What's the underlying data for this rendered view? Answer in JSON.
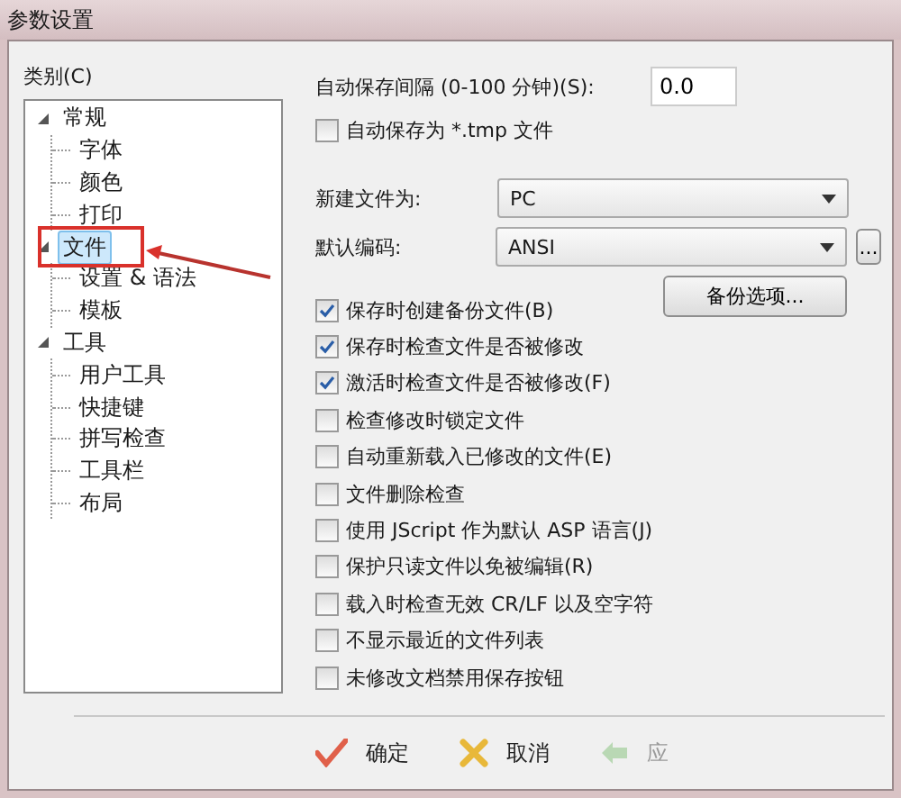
{
  "window": {
    "title": "参数设置"
  },
  "category": {
    "label": "类别(C)",
    "tree": [
      {
        "label": "常规",
        "expanded": true,
        "selected": false,
        "children": [
          {
            "label": "字体",
            "selected": false
          },
          {
            "label": "颜色",
            "selected": false
          },
          {
            "label": "打印",
            "selected": false
          }
        ]
      },
      {
        "label": "文件",
        "expanded": true,
        "selected": true,
        "children": [
          {
            "label": "设置 & 语法",
            "selected": false
          },
          {
            "label": "模板",
            "selected": false
          }
        ]
      },
      {
        "label": "工具",
        "expanded": true,
        "selected": false,
        "children": [
          {
            "label": "用户工具",
            "selected": false
          },
          {
            "label": "快捷键",
            "selected": false
          },
          {
            "label": "拼写检查",
            "selected": false
          },
          {
            "label": "工具栏",
            "selected": false
          },
          {
            "label": "布局",
            "selected": false
          }
        ]
      }
    ]
  },
  "autosave_interval": {
    "label": "自动保存间隔 (0-100 分钟)(S):",
    "value": "0.0"
  },
  "autosave_tmp": {
    "label": "自动保存为 *.tmp 文件",
    "checked": false
  },
  "new_file_as": {
    "label": "新建文件为:",
    "value": "PC"
  },
  "default_encoding": {
    "label": "默认编码:",
    "value": "ANSI",
    "more": "..."
  },
  "backup_button": "备份选项...",
  "options": [
    {
      "label": "保存时创建备份文件(B)",
      "checked": true
    },
    {
      "label": "保存时检查文件是否被修改",
      "checked": true
    },
    {
      "label": "激活时检查文件是否被修改(F)",
      "checked": true
    },
    {
      "label": "检查修改时锁定文件",
      "checked": false
    },
    {
      "label": "自动重新载入已修改的文件(E)",
      "checked": false
    },
    {
      "label": "文件删除检查",
      "checked": false
    },
    {
      "label": "使用 JScript 作为默认 ASP 语言(J)",
      "checked": false
    },
    {
      "label": "保护只读文件以免被编辑(R)",
      "checked": false
    },
    {
      "label": "载入时检查无效 CR/LF 以及空字符",
      "checked": false
    },
    {
      "label": "不显示最近的文件列表",
      "checked": false
    },
    {
      "label": "未修改文档禁用保存按钮",
      "checked": false
    }
  ],
  "buttons": [
    {
      "kind": "ok",
      "label": "确定",
      "disabled": false
    },
    {
      "kind": "cancel",
      "label": "取消",
      "disabled": false
    },
    {
      "kind": "apply",
      "label": "应",
      "disabled": true
    }
  ]
}
